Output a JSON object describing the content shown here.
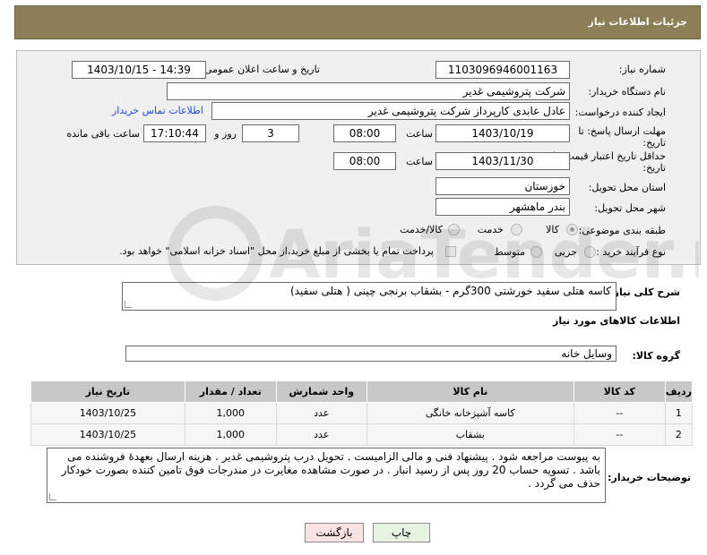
{
  "header": {
    "title": "جزئیات اطلاعات نیاز"
  },
  "form": {
    "need_number_label": "شماره نیاز:",
    "need_number": "1103096946001163",
    "announce_label": "تاریخ و ساعت اعلان عمومی:",
    "announce_value": "1403/10/15 - 14:39",
    "buyer_org_label": "نام دستگاه خریدار:",
    "buyer_org": "شرکت پتروشیمی غدیر",
    "creator_label": "ایجاد کننده درخواست:",
    "creator": "عادل عابدی کارپرداز شرکت پتروشیمی غدیر",
    "contact_link": "اطلاعات تماس خریدار",
    "deadline_label_line1": "مهلت ارسال پاسخ: تا",
    "deadline_label_line2": "تاریخ:",
    "deadline_date": "1403/10/19",
    "time_label": "ساعت",
    "deadline_time": "08:00",
    "days_value": "3",
    "days_label": "روز و",
    "remaining_time": "17:10:44",
    "remaining_label": "ساعت باقی مانده",
    "validity_label_line1": "حداقل تاریخ اعتبار قیمت: تا",
    "validity_label_line2": "تاریخ:",
    "validity_date": "1403/11/30",
    "validity_time": "08:00",
    "province_label": "استان محل تحویل:",
    "province": "خوزستان",
    "city_label": "شهر محل تحویل:",
    "city": "بندر ماهشهر",
    "category_label": "طبقه بندی موضوعی:",
    "category_options": [
      "کالا",
      "خدمت",
      "کالا/خدمت"
    ],
    "process_label": "نوع فرآیند خرید :",
    "process_options": [
      "جزیی",
      "متوسط"
    ],
    "payment_note": "پرداخت تمام یا بخشی از مبلغ خرید،از محل \"اسناد خزانه اسلامی\" خواهد بود."
  },
  "summary": {
    "label": "شرح کلی نیاز:",
    "value": "کاسه هتلی سفید خورشتی 300گرم - بشقاب برنجی چینی ( هتلی سفید)"
  },
  "goods": {
    "section_title": "اطلاعات کالاهای مورد نیاز",
    "group_label": "گروه کالا:",
    "group_value": "وسایل خانه",
    "columns": [
      "ردیف",
      "کد کالا",
      "نام کالا",
      "واحد شمارش",
      "تعداد / مقدار",
      "تاریخ نیاز"
    ],
    "rows": [
      [
        "1",
        "--",
        "کاسه آشپزخانه خانگی",
        "عدد",
        "1,000",
        "1403/10/25"
      ],
      [
        "2",
        "--",
        "بشقاب",
        "عدد",
        "1,000",
        "1403/10/25"
      ]
    ]
  },
  "buyer_notes": {
    "label": "توضیحات خریدار:",
    "value": "به پیوست مراجعه شود . پیشنهاد فنی و مالی الزامیست . تحویل درب پتروشیمی غدیر . هزینه ارسال بعهدهٔ فروشنده می باشد . تسویه حساب 20 روز پس از رسید انبار .  در صورت مشاهده مغایرت در مندرجات فوق تامین کننده بصورت خودکار حذف می گردد ."
  },
  "buttons": {
    "print": "چاپ",
    "back": "بازگشت"
  },
  "watermark": "AriaTender.net",
  "colors": {
    "header_bg": "#8c7e57",
    "link": "#1d4fd8",
    "print_bg": "#e8f4e3",
    "back_bg": "#fbe3e3"
  }
}
